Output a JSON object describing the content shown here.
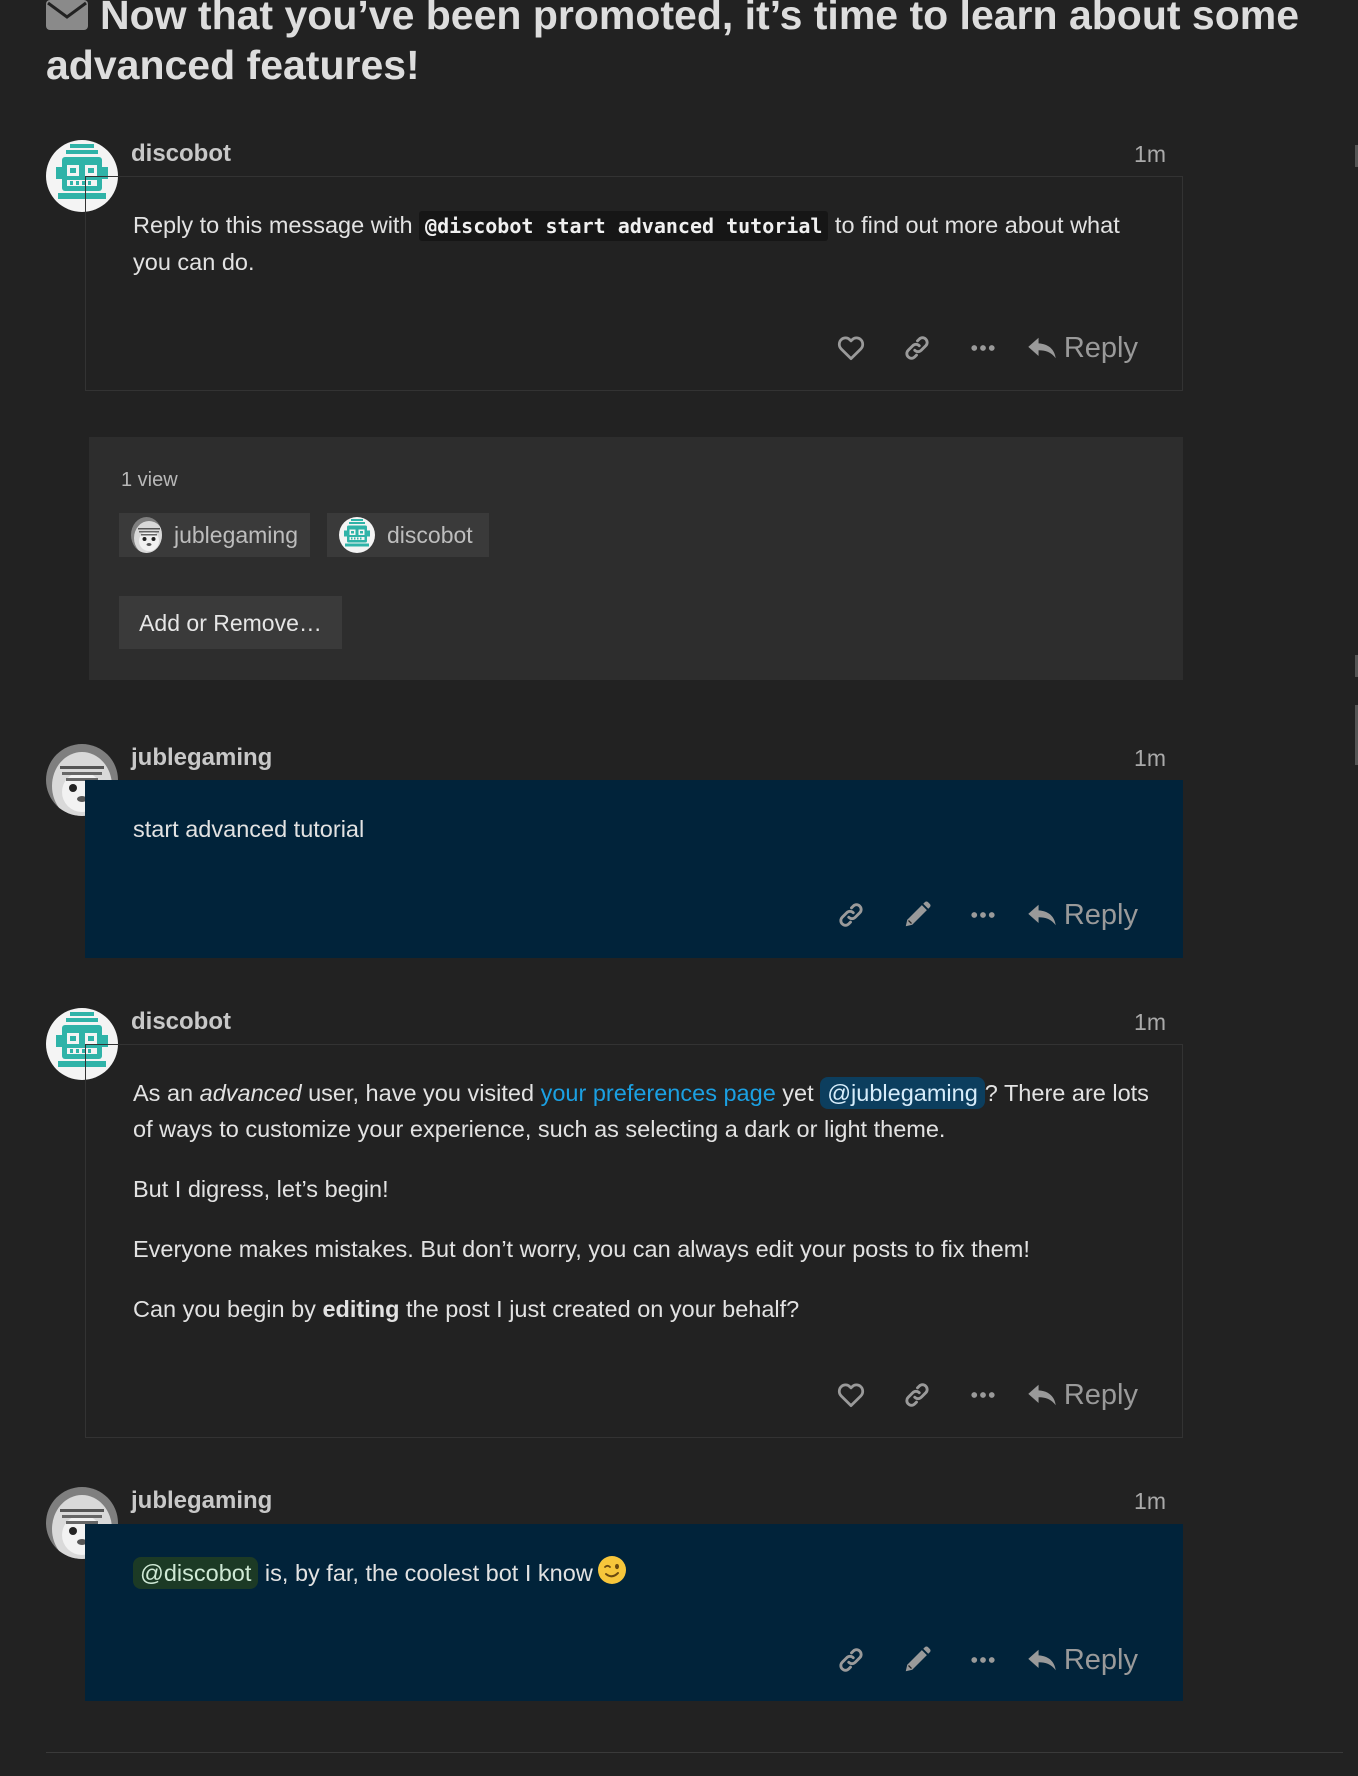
{
  "topic": {
    "icon": "envelope-icon",
    "title": "Now that you’ve been promoted, it’s time to learn about some advanced features!"
  },
  "posts": [
    {
      "author": "discobot",
      "time": "1m",
      "avatar": "robot-avatar",
      "body": {
        "before": "Reply to this message with ",
        "code": "@discobot start advanced tutorial",
        "after": " to find out more about what you can do."
      },
      "actions": [
        "heart-icon",
        "link-icon",
        "more-icon"
      ],
      "reply_label": "Reply"
    },
    {
      "author": "jublegaming",
      "time": "1m",
      "avatar": "photo-avatar",
      "body": {
        "text": "start advanced tutorial"
      },
      "actions": [
        "link-icon",
        "pencil-icon",
        "more-icon"
      ],
      "reply_label": "Reply"
    },
    {
      "author": "discobot",
      "time": "1m",
      "avatar": "robot-avatar",
      "body": {
        "p1_a": "As an ",
        "p1_em": "advanced",
        "p1_b": " user, have you visited ",
        "p1_link": "your preferences page",
        "p1_c": " yet ",
        "p1_mention": "@jublegaming",
        "p1_d": "? There are lots of ways to customize your experience, such as selecting a dark or light theme.",
        "p2": "But I digress, let’s begin!",
        "p3": "Everyone makes mistakes. But don’t worry, you can always edit your posts to fix them!",
        "p4_a": "Can you begin by ",
        "p4_strong": "editing",
        "p4_b": " the post I just created on your behalf?"
      },
      "actions": [
        "heart-icon",
        "link-icon",
        "more-icon"
      ],
      "reply_label": "Reply"
    },
    {
      "author": "jublegaming",
      "time": "1m",
      "avatar": "photo-avatar",
      "body": {
        "mention": "@discobot",
        "text": " is, by far, the coolest bot I know",
        "emoji": "wink-emoji"
      },
      "actions": [
        "link-icon",
        "pencil-icon",
        "more-icon"
      ],
      "reply_label": "Reply"
    }
  ],
  "pm": {
    "views": "1 view",
    "participants": [
      "jublegaming",
      "discobot"
    ],
    "add_remove_label": "Add or Remove…"
  },
  "colors": {
    "background": "#222222",
    "self_post": "#01233a",
    "link": "#1ba0e2",
    "mention": "#0c3e5e",
    "robot_teal": "#35b3a8"
  }
}
